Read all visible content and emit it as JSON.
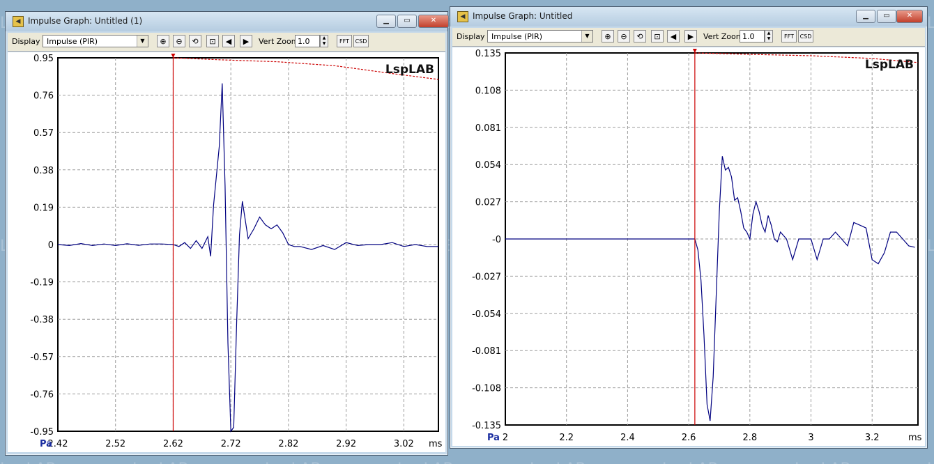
{
  "desktop": {
    "watermark": "LspLAB"
  },
  "windows": [
    {
      "title": "Impulse Graph: Untitled (1)",
      "toolbar": {
        "display_label": "Display",
        "display_value": "Impulse (PIR)",
        "vert_zoom_label": "Vert Zoom",
        "vert_zoom_value": "1.0",
        "fft_label": "FFT",
        "csd_label": "CSD"
      },
      "chart_data": {
        "type": "line",
        "brand": "LspLAB",
        "x_unit": "ms",
        "y_unit": "Pa",
        "xlim": [
          2.42,
          3.08
        ],
        "ylim": [
          -0.95,
          0.95
        ],
        "x_ticks": [
          2.42,
          2.52,
          2.62,
          2.72,
          2.82,
          2.92,
          3.02
        ],
        "x_tick_labels": [
          "2.42",
          "2.52",
          "2.62",
          "2.72",
          "2.82",
          "2.92",
          "3.02"
        ],
        "y_ticks": [
          0.95,
          0.76,
          0.57,
          0.38,
          0.19,
          0,
          -0.19,
          -0.38,
          -0.57,
          -0.76,
          -0.95
        ],
        "y_tick_labels": [
          "0.95",
          "0.76",
          "0.57",
          "0.38",
          "0.19",
          "0",
          "-0.19",
          "-0.38",
          "-0.57",
          "-0.76",
          "-0.95"
        ],
        "grid": true,
        "marker_x": 2.62,
        "series": [
          {
            "color": "#000080",
            "x": [
              2.42,
              2.44,
              2.46,
              2.48,
              2.5,
              2.52,
              2.54,
              2.56,
              2.58,
              2.6,
              2.62,
              2.63,
              2.64,
              2.65,
              2.66,
              2.67,
              2.68,
              2.685,
              2.69,
              2.7,
              2.705,
              2.71,
              2.715,
              2.72,
              2.725,
              2.73,
              2.735,
              2.74,
              2.75,
              2.76,
              2.77,
              2.78,
              2.79,
              2.8,
              2.81,
              2.82,
              2.83,
              2.84,
              2.86,
              2.88,
              2.9,
              2.92,
              2.94,
              2.96,
              2.98,
              3.0,
              3.02,
              3.04,
              3.06,
              3.08
            ],
            "y": [
              0.0,
              -0.005,
              0.005,
              -0.005,
              0.003,
              -0.005,
              0.004,
              -0.004,
              0.003,
              0.003,
              0.0,
              -0.01,
              0.01,
              -0.02,
              0.02,
              -0.02,
              0.04,
              -0.06,
              0.2,
              0.5,
              0.82,
              0.3,
              -0.5,
              -0.95,
              -0.93,
              -0.4,
              0.05,
              0.22,
              0.03,
              0.08,
              0.14,
              0.1,
              0.08,
              0.1,
              0.06,
              0.0,
              -0.01,
              -0.01,
              -0.025,
              -0.005,
              -0.025,
              0.01,
              -0.005,
              0.0,
              0.0,
              0.01,
              -0.01,
              0.0,
              -0.01,
              -0.01
            ]
          },
          {
            "color": "#cc0000",
            "dashed": true,
            "x": [
              2.62,
              2.7,
              2.8,
              2.9,
              3.0,
              3.08
            ],
            "y": [
              0.95,
              0.94,
              0.93,
              0.91,
              0.87,
              0.84
            ]
          }
        ]
      }
    },
    {
      "title": "Impulse Graph: Untitled",
      "toolbar": {
        "display_label": "Display",
        "display_value": "Impulse (PIR)",
        "vert_zoom_label": "Vert Zoom",
        "vert_zoom_value": "1.0",
        "fft_label": "FFT",
        "csd_label": "CSD"
      },
      "chart_data": {
        "type": "line",
        "brand": "LspLAB",
        "x_unit": "ms",
        "y_unit": "Pa",
        "xlim": [
          2.0,
          3.35
        ],
        "ylim": [
          -0.135,
          0.135
        ],
        "x_ticks": [
          2.0,
          2.2,
          2.4,
          2.6,
          2.8,
          3.0,
          3.2
        ],
        "x_tick_labels": [
          "2",
          "2.2",
          "2.4",
          "2.6",
          "2.8",
          "3",
          "3.2"
        ],
        "y_ticks": [
          0.135,
          0.108,
          0.081,
          0.054,
          0.027,
          0,
          -0.027,
          -0.054,
          -0.081,
          -0.108,
          -0.135
        ],
        "y_tick_labels": [
          "0.135",
          "0.108",
          "0.081",
          "0.054",
          "0.027",
          "-0",
          "-0.027",
          "-0.054",
          "-0.081",
          "-0.108",
          "-0.135"
        ],
        "grid": true,
        "marker_x": 2.62,
        "series": [
          {
            "color": "#000080",
            "x": [
              2.0,
              2.4,
              2.62,
              2.63,
              2.64,
              2.65,
              2.66,
              2.67,
              2.68,
              2.69,
              2.7,
              2.71,
              2.72,
              2.73,
              2.74,
              2.75,
              2.76,
              2.77,
              2.78,
              2.79,
              2.8,
              2.81,
              2.82,
              2.83,
              2.84,
              2.85,
              2.86,
              2.87,
              2.88,
              2.89,
              2.9,
              2.92,
              2.94,
              2.96,
              2.98,
              3.0,
              3.02,
              3.04,
              3.06,
              3.08,
              3.1,
              3.12,
              3.14,
              3.16,
              3.18,
              3.2,
              3.22,
              3.24,
              3.26,
              3.28,
              3.3,
              3.32,
              3.34
            ],
            "y": [
              0.0,
              0.0,
              0.0,
              -0.008,
              -0.03,
              -0.07,
              -0.12,
              -0.132,
              -0.1,
              -0.04,
              0.02,
              0.06,
              0.05,
              0.052,
              0.045,
              0.028,
              0.03,
              0.02,
              0.008,
              0.005,
              0.0,
              0.018,
              0.027,
              0.02,
              0.01,
              0.005,
              0.017,
              0.01,
              0.0,
              -0.002,
              0.005,
              0.0,
              -0.015,
              0.0,
              0.0,
              0.0,
              -0.015,
              0.0,
              0.0,
              0.005,
              0.0,
              -0.005,
              0.012,
              0.01,
              0.008,
              -0.015,
              -0.018,
              -0.01,
              0.005,
              0.005,
              0.0,
              -0.005,
              -0.006
            ]
          },
          {
            "color": "#cc0000",
            "dashed": true,
            "x": [
              2.62,
              2.8,
              3.0,
              3.2,
              3.35
            ],
            "y": [
              0.135,
              0.134,
              0.133,
              0.131,
              0.128
            ]
          }
        ]
      }
    }
  ]
}
